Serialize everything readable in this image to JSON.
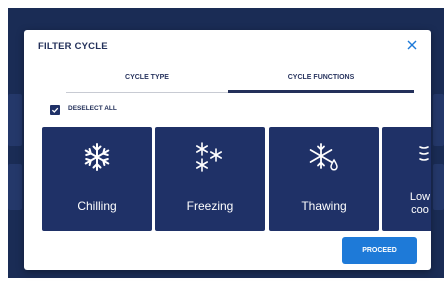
{
  "dialog": {
    "title": "FILTER CYCLE",
    "close_icon": "close-icon"
  },
  "tabs": [
    {
      "label": "CYCLE TYPE",
      "active": false
    },
    {
      "label": "CYCLE FUNCTIONS",
      "active": true
    }
  ],
  "deselect": {
    "label": "DESELECT ALL",
    "checked": true
  },
  "cards": [
    {
      "label": "Chilling",
      "icon": "snowflake-icon"
    },
    {
      "label": "Freezing",
      "icon": "snowflakes-icon"
    },
    {
      "label": "Thawing",
      "icon": "snowflake-drop-icon"
    },
    {
      "label": "Low\ncoo",
      "icon": "wave-icon"
    }
  ],
  "proceed": {
    "label": "PROCEED"
  },
  "colors": {
    "primary": "#1f3167",
    "accent": "#1e7ad8",
    "backdrop": "#1a2c55"
  }
}
